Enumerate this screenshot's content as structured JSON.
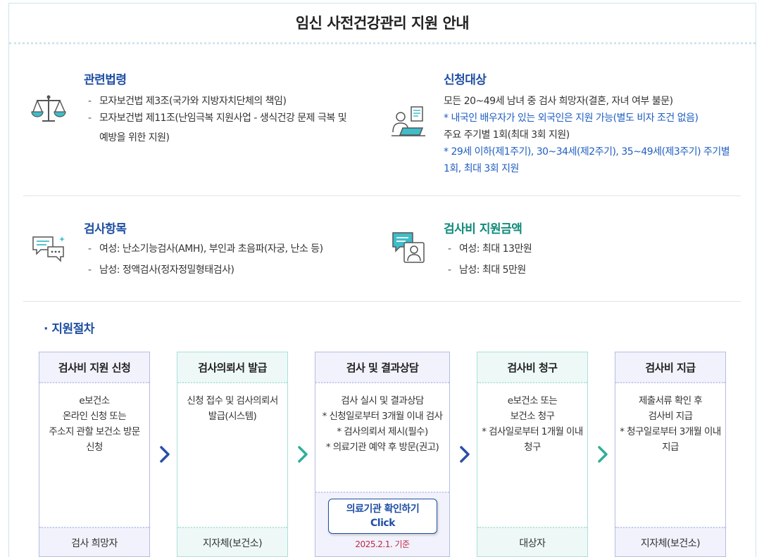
{
  "page_title": "임신 사전건강관리 지원 안내",
  "laws": {
    "title": "관련법령",
    "items": [
      "모자보건법 제3조(국가와 지방자치단체의 책임)",
      "모자보건법 제11조(난임극복 지원사업 - 생식건강 문제 극복 및",
      "예방을 위한 지원)"
    ]
  },
  "eligibility": {
    "title": "신청대상",
    "line1": "모든 20~49세 남녀 중 검사 희망자(결혼, 자녀 여부 불문)",
    "note1": "* 내국인 배우자가 있는 외국인은 지원 가능(별도 비자 조건 없음)",
    "line2": "주요 주기별 1회(최대 3회 지원)",
    "note2a": "* 29세 이하(제1주기), 30~34세(제2주기), 35~49세(제3주기) 주기별",
    "note2b": "1회, 최대 3회 지원"
  },
  "tests": {
    "title": "검사항목",
    "items": [
      "여성: 난소기능검사(AMH), 부인과 초음파(자궁, 난소 등)",
      "남성: 정액검사(정자정밀형태검사)"
    ]
  },
  "support_amount": {
    "title": "검사비 지원금액",
    "items": [
      "여성: 최대 13만원",
      "남성: 최대 5만원"
    ]
  },
  "procedure": {
    "title": "· 지원절차",
    "steps": [
      {
        "head": "검사비 지원 신청",
        "body": "e보건소\n온라인 신청 또는\n주소지 관할 보건소 방문\n신청",
        "foot": "검사 희망자"
      },
      {
        "head": "검사의뢰서 발급",
        "body": "신청 접수 및 검사의뢰서\n발급(시스템)",
        "foot": "지자체(보건소)"
      },
      {
        "head": "검사 및 결과상담",
        "body": "검사 실시 및 결과상담\n* 신청일로부터 3개월 이내 검사\n* 검사의뢰서 제시(필수)\n* 의료기관 예약 후 방문(권고)",
        "button_line1": "의료기관 확인하기",
        "button_line2": "Click",
        "note": "2025.2.1. 기준"
      },
      {
        "head": "검사비 청구",
        "body": "e보건소 또는\n보건소 청구\n* 검사일로부터 1개월 이내\n청구",
        "foot": "대상자"
      },
      {
        "head": "검사비 지급",
        "body": "제출서류 확인 후\n검사비 지급\n* 청구일로부터 3개월 이내\n지급",
        "foot": "지자체(보건소)"
      }
    ]
  },
  "colors": {
    "blue": "#1f4fa3",
    "teal": "#0f8a7a",
    "note_blue": "#1f5ec0",
    "note_red": "#c0264a"
  },
  "icons": [
    "scale-icon",
    "person-laptop-icon",
    "chat-bubbles-icon",
    "consultation-icon",
    "chevron-right-icon"
  ]
}
